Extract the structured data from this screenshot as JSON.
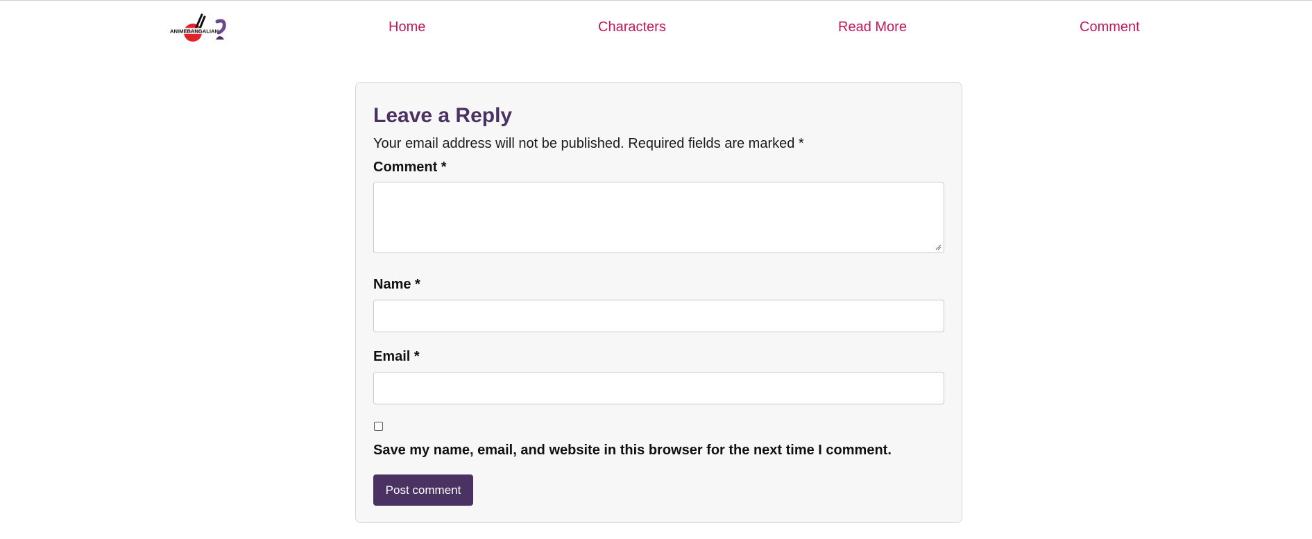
{
  "nav": {
    "logo_icon": "anime-site-logo-icon",
    "logo_text": "ANIMEBANGALIAN",
    "items": [
      {
        "label": "Home"
      },
      {
        "label": "Characters"
      },
      {
        "label": "Read More"
      },
      {
        "label": "Comment"
      }
    ]
  },
  "form": {
    "title": "Leave a Reply",
    "notice": "Your email address will not be published. Required fields are marked *",
    "comment_label": "Comment *",
    "comment_value": "",
    "name_label": "Name *",
    "name_value": "",
    "email_label": "Email *",
    "email_value": "",
    "save_checked": false,
    "save_label": "Save my name, email, and website in this browser for the next time I comment.",
    "submit_label": "Post comment"
  },
  "colors": {
    "link": "#c2185b",
    "heading": "#4a3263",
    "button_bg": "#4a3263",
    "card_bg": "#f7f7f7"
  }
}
